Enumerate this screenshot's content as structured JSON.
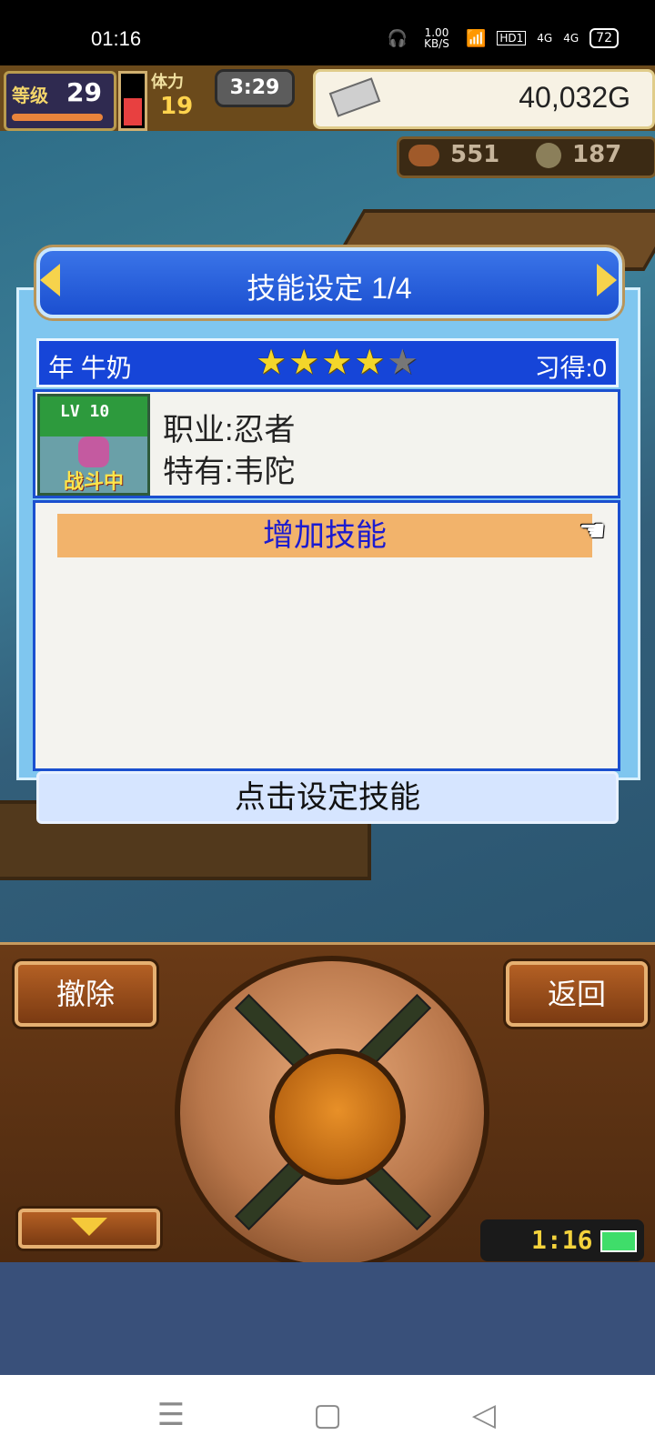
{
  "status_bar": {
    "time": "01:16",
    "net_speed": "1.00 KB/S",
    "hd": "HD1",
    "network1": "4G",
    "network2": "4G",
    "battery": "72",
    "icons": [
      "headphones-icon",
      "wifi-icon",
      "signal-icon",
      "signal-icon",
      "battery-icon"
    ]
  },
  "hud": {
    "level_label": "等级",
    "level_value": "29",
    "stamina_label": "体力",
    "stamina_value": "19",
    "timer": "3:29",
    "money": "40,032G",
    "food": "551",
    "material": "187"
  },
  "dialog": {
    "title": "技能设定 1/4",
    "character_name": "年 牛奶",
    "stars_total": 5,
    "stars_filled": 4,
    "learned": "习得:0",
    "portrait_level": "LV 10",
    "portrait_status": "战斗中",
    "job": "职业:忍者",
    "special": "特有:韦陀",
    "add_skill": "增加技能",
    "hint": "点击设定技能"
  },
  "controls": {
    "remove": "撤除",
    "back": "返回",
    "clock": "1:16"
  },
  "navbar": {
    "menu_icon": "☰",
    "home_icon": "▢",
    "back_icon": "◁"
  },
  "colors": {
    "dialog_blue": "#1645d8",
    "highlight_orange": "#f2b36b",
    "star_gold": "#f4d62a",
    "wood_brown": "#6a3a16"
  }
}
